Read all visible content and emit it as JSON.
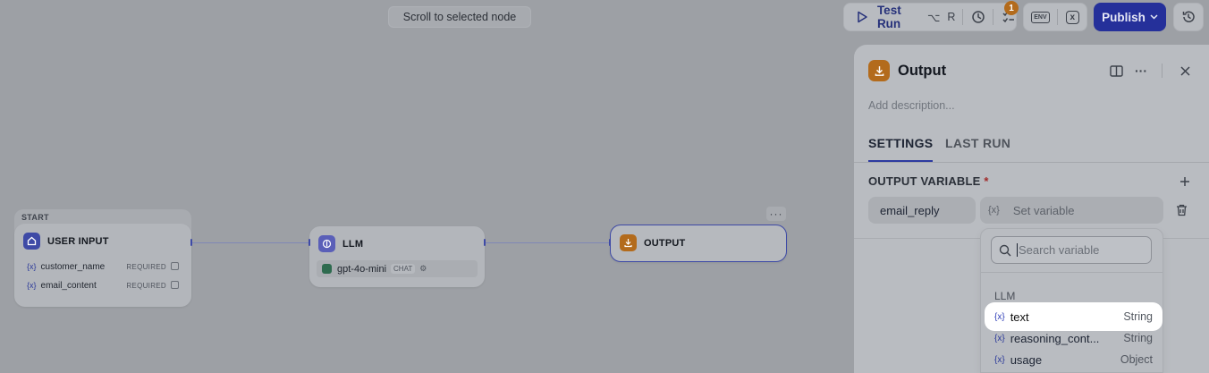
{
  "toolbar": {
    "scroll_hint": "Scroll to selected node",
    "test_run_label": "Test Run",
    "shortcut_modifier": "⌥",
    "shortcut_key": "R",
    "checklist_badge": "1",
    "env_label": "ENV",
    "conversation_var_label": "x",
    "publish_label": "Publish"
  },
  "canvas": {
    "start_tag": "START",
    "user_input_node": {
      "title": "USER INPUT",
      "variables": [
        {
          "symbol": "{x}",
          "name": "customer_name",
          "required": "REQUIRED"
        },
        {
          "symbol": "{x}",
          "name": "email_content",
          "required": "REQUIRED"
        }
      ]
    },
    "llm_node": {
      "title": "LLM",
      "model": "gpt-4o-mini",
      "mode": "CHAT"
    },
    "output_node": {
      "title": "OUTPUT"
    }
  },
  "panel": {
    "title": "Output",
    "description_placeholder": "Add description...",
    "tabs": [
      "SETTINGS",
      "LAST RUN"
    ],
    "section_label": "OUTPUT VARIABLE",
    "required_marker": "*",
    "variable_name": "email_reply",
    "variable_symbol": "{x}",
    "variable_placeholder": "Set variable",
    "dropdown": {
      "search_placeholder": "Search variable",
      "group_label": "LLM",
      "items": [
        {
          "symbol": "{x}",
          "name": "text",
          "type": "String"
        },
        {
          "symbol": "{x}",
          "name": "reasoning_cont...",
          "type": "String"
        },
        {
          "symbol": "{x}",
          "name": "usage",
          "type": "Object"
        }
      ]
    }
  },
  "colors": {
    "accent": "#25309a",
    "output_icon": "#b36b1c",
    "user_input_icon": "#3e4aa6",
    "llm_icon": "#5a5fb8",
    "badge": "#b36b1c"
  }
}
